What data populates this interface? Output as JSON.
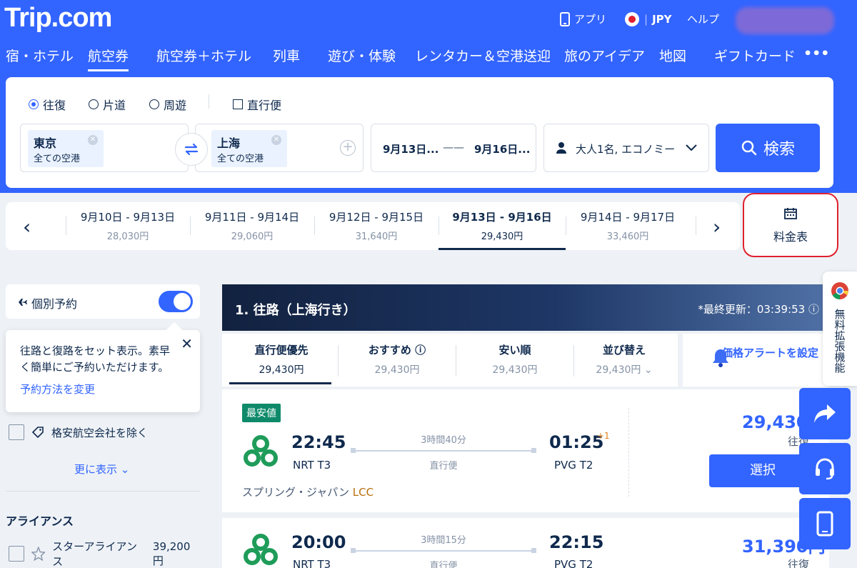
{
  "header": {
    "logo": "Trip.com",
    "app_label": "アプリ",
    "currency": "JPY",
    "help": "ヘルプ"
  },
  "nav": {
    "items": [
      "宿・ホテル",
      "航空券",
      "航空券＋ホテル",
      "列車",
      "遊び・体験",
      "レンタカー＆空港送迎",
      "旅のアイデア",
      "地図",
      "ギフトカード",
      "•••"
    ],
    "active_index": 1
  },
  "search": {
    "trip_types": [
      "往復",
      "片道",
      "周遊"
    ],
    "selected_trip_type": "往復",
    "direct_only_label": "直行便",
    "direct_only_checked": false,
    "origin": {
      "city": "東京",
      "sub": "全ての空港"
    },
    "destination": {
      "city": "上海",
      "sub": "全ての空港"
    },
    "depart_date": "9月13日...",
    "return_date": "9月16日...",
    "date_sep": "——",
    "passengers": "大人1名, エコノミー",
    "search_button": "検索"
  },
  "date_strip": {
    "items": [
      {
        "dates": "9月10日 - 9月13日",
        "price": "28,030円"
      },
      {
        "dates": "9月11日 - 9月14日",
        "price": "29,060円"
      },
      {
        "dates": "9月12日 - 9月15日",
        "price": "31,640円"
      },
      {
        "dates": "9月13日 - 9月16日",
        "price": "29,430円",
        "selected": true
      },
      {
        "dates": "9月14日 - 9月17日",
        "price": "33,460円"
      }
    ],
    "price_table_label": "料金表"
  },
  "sidebar": {
    "individual_booking": "個別予約",
    "individual_booking_on": true,
    "tooltip_text": "往路と復路をセット表示。素早く簡単にご予約いただけます。",
    "tooltip_link": "予約方法を変更",
    "exclude_lcc": "格安航空会社を除く",
    "show_more": "更に表示",
    "alliance_heading": "アライアンス",
    "alliances": [
      {
        "name": "スターアライアンス",
        "price": "39,200円"
      }
    ]
  },
  "results": {
    "heading": "1. 往路（上海行き）",
    "updated": "*最終更新：03:39:53",
    "sort_tabs": [
      {
        "label": "直行便優先",
        "price": "29,430円",
        "selected": true
      },
      {
        "label": "おすすめ",
        "price": "29,430円"
      },
      {
        "label": "安い順",
        "price": "29,430円"
      },
      {
        "label": "並び替え",
        "price": "29,430円"
      }
    ],
    "price_alert": "価格アラートを設定",
    "flights": [
      {
        "badge": "最安値",
        "dep_time": "22:45",
        "dep_airport": "NRT T3",
        "duration": "3時間40分",
        "stops": "直行便",
        "arr_time": "01:25",
        "arr_airport": "PVG T2",
        "day_offset": "+1",
        "airline": "スプリング・ジャパン",
        "lcc": "LCC",
        "price": "29,430円",
        "price_type": "往復",
        "select": "選択"
      },
      {
        "dep_time": "20:00",
        "dep_airport": "NRT T3",
        "duration": "3時間15分",
        "stops": "直行便",
        "arr_time": "22:15",
        "arr_airport": "PVG T2",
        "price": "31,390円",
        "price_type": "往復"
      }
    ]
  },
  "extension": {
    "label": "無料拡張機能"
  },
  "colors": {
    "brand": "#3264ff",
    "header_bg": "#3264ff",
    "badge": "#0e8a6a",
    "highlight": "#e0202e"
  }
}
